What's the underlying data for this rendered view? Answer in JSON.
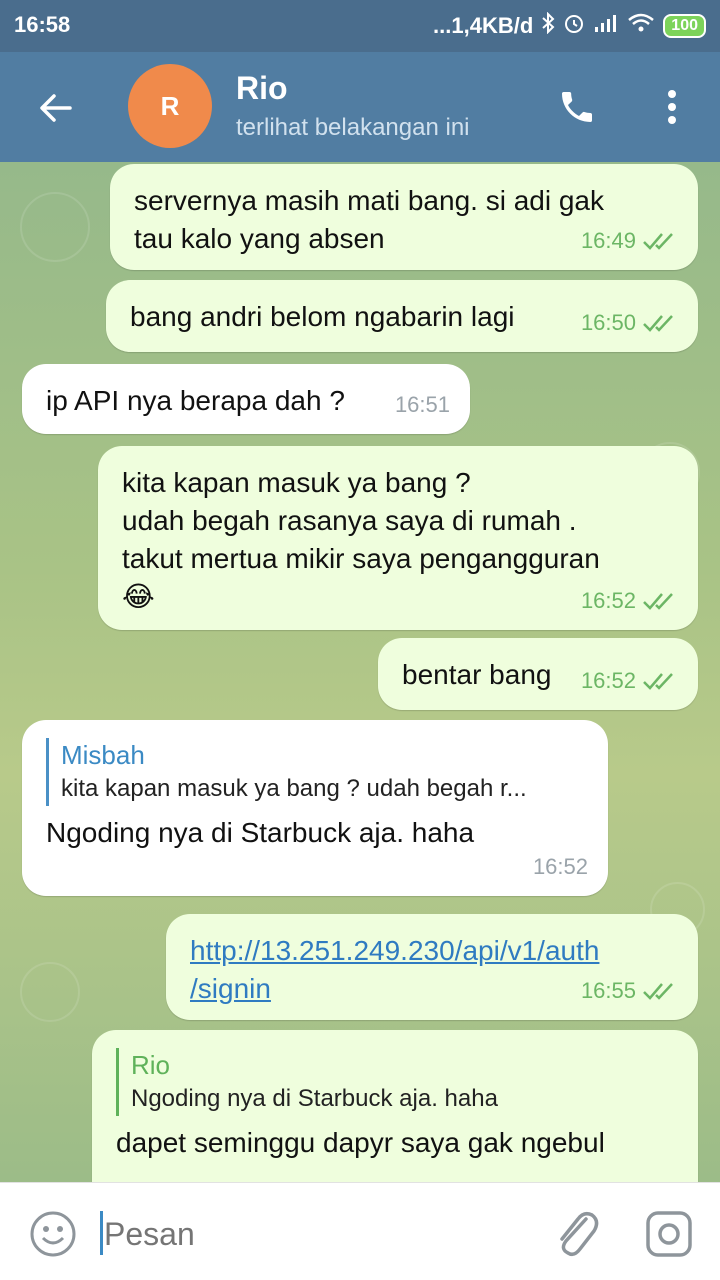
{
  "status_bar": {
    "time": "16:58",
    "network": "...1,4KB/d",
    "battery": "100"
  },
  "header": {
    "avatar_letter": "R",
    "name": "Rio",
    "status": "terlihat belakangan ini"
  },
  "messages": [
    {
      "dir": "out",
      "text_lines": [
        "servernya masih mati bang. si adi gak",
        "tau kalo yang absen"
      ],
      "time": "16:49"
    },
    {
      "dir": "out",
      "text_lines": [
        "bang andri belom ngabarin lagi"
      ],
      "time": "16:50"
    },
    {
      "dir": "in",
      "text_lines": [
        "ip API nya berapa dah ?"
      ],
      "time": "16:51"
    },
    {
      "dir": "out",
      "text_lines": [
        "kita kapan masuk ya bang ?",
        "udah begah rasanya saya di rumah .",
        "takut mertua mikir saya pengangguran",
        "😂"
      ],
      "time": "16:52"
    },
    {
      "dir": "out",
      "text_lines": [
        "bentar bang"
      ],
      "time": "16:52"
    },
    {
      "dir": "in",
      "reply_to": {
        "name": "Misbah",
        "text": "kita kapan masuk ya bang ? udah begah r..."
      },
      "text_lines": [
        "Ngoding nya di Starbuck aja. haha"
      ],
      "time": "16:52"
    },
    {
      "dir": "out",
      "link_lines": [
        "http://13.251.249.230/api/v1/auth",
        "/signin"
      ],
      "time": "16:55"
    },
    {
      "dir": "out",
      "reply_to": {
        "name": "Rio",
        "text": "Ngoding nya di Starbuck aja. haha"
      },
      "text_lines": [
        "dapet seminggu dapyr saya gak ngebul"
      ]
    }
  ],
  "input": {
    "placeholder": "Pesan"
  }
}
